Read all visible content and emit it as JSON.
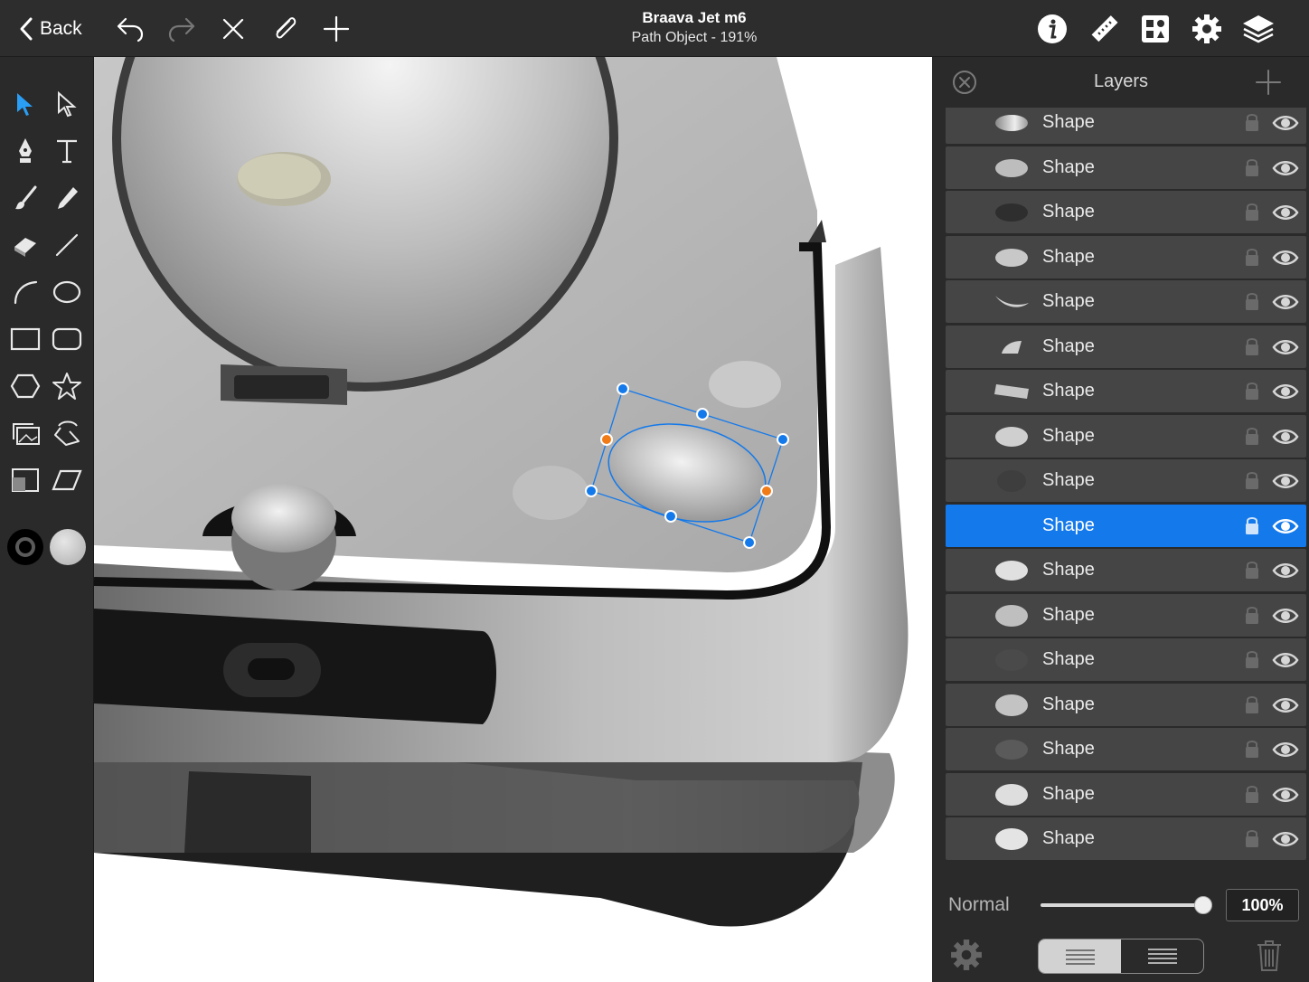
{
  "topbar": {
    "back_label": "Back",
    "title": "Braava Jet m6",
    "subtitle": "Path Object - 191%",
    "icons": [
      "undo-icon",
      "redo-icon",
      "close-icon",
      "paperclip-icon",
      "plus-icon",
      "info-icon",
      "ruler-icon",
      "grid-icon",
      "gear-icon",
      "layers-icon"
    ]
  },
  "tools": [
    "select-icon",
    "direct-select-icon",
    "pen-icon",
    "text-icon",
    "brush-icon",
    "pencil-icon",
    "eraser-icon",
    "line-icon",
    "arc-icon",
    "ellipse-icon",
    "rectangle-icon",
    "rounded-rectangle-icon",
    "hexagon-icon",
    "star-icon",
    "image-icon",
    "freeform-icon",
    "crop-icon",
    "parallelogram-icon"
  ],
  "colors": {
    "stroke": "#000000",
    "fill": "#cfcfcf",
    "accent": "#1479ea"
  },
  "layers_panel": {
    "title": "Layers",
    "layers": [
      {
        "name": "Shape",
        "selected": false
      },
      {
        "name": "Shape",
        "selected": false
      },
      {
        "name": "Shape",
        "selected": false
      },
      {
        "name": "Shape",
        "selected": false
      },
      {
        "name": "Shape",
        "selected": false
      },
      {
        "name": "Shape",
        "selected": false
      },
      {
        "name": "Shape",
        "selected": false
      },
      {
        "name": "Shape",
        "selected": false
      },
      {
        "name": "Shape",
        "selected": false
      },
      {
        "name": "Shape",
        "selected": true
      },
      {
        "name": "Shape",
        "selected": false
      },
      {
        "name": "Shape",
        "selected": false
      },
      {
        "name": "Shape",
        "selected": false
      },
      {
        "name": "Shape",
        "selected": false
      },
      {
        "name": "Shape",
        "selected": false
      },
      {
        "name": "Shape",
        "selected": false
      },
      {
        "name": "Shape",
        "selected": false
      }
    ],
    "blend_mode": "Normal",
    "opacity_label": "100%",
    "opacity": 1.0
  }
}
